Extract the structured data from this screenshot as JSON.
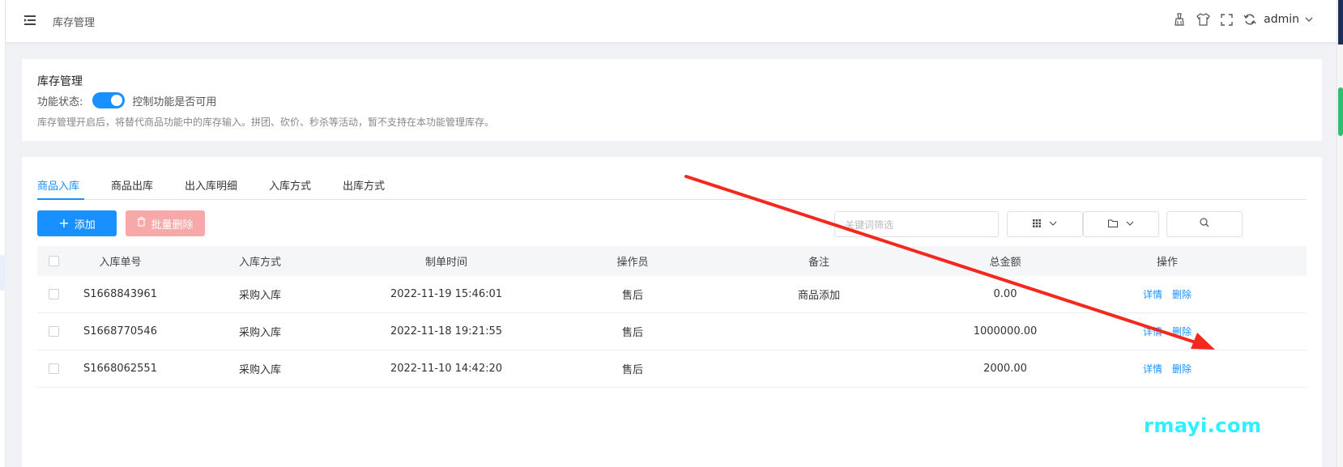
{
  "topbar": {
    "title": "库存管理",
    "icons": [
      "broom-icon",
      "tshirt-icon",
      "fullscreen-icon",
      "refresh-icon"
    ],
    "username": "admin"
  },
  "settings_card": {
    "title": "库存管理",
    "status_label": "功能状态:",
    "switch_on": true,
    "switch_hint": "控制功能是否可用",
    "description": "库存管理开启后，将替代商品功能中的库存输入。拼团、砍价、秒杀等活动，暂不支持在本功能管理库存。"
  },
  "tabs": [
    {
      "label": "商品入库",
      "active": true
    },
    {
      "label": "商品出库",
      "active": false
    },
    {
      "label": "出入库明细",
      "active": false
    },
    {
      "label": "入库方式",
      "active": false
    },
    {
      "label": "出库方式",
      "active": false
    }
  ],
  "toolbar": {
    "add_label": "添加",
    "batch_delete_label": "批量删除",
    "search_placeholder": "关键词筛选"
  },
  "table": {
    "headers": [
      "入库单号",
      "入库方式",
      "制单时间",
      "操作员",
      "备注",
      "总金额",
      "操作"
    ],
    "rows": [
      {
        "no": "S1668843961",
        "method": "采购入库",
        "time": "2022-11-19 15:46:01",
        "operator": "售后",
        "remark": "商品添加",
        "amount": "0.00",
        "detail": "详情",
        "delete": "删除"
      },
      {
        "no": "S1668770546",
        "method": "采购入库",
        "time": "2022-11-18 19:21:55",
        "operator": "售后",
        "remark": "",
        "amount": "1000000.00",
        "detail": "详情",
        "delete": "删除"
      },
      {
        "no": "S1668062551",
        "method": "采购入库",
        "time": "2022-11-10 14:42:20",
        "operator": "售后",
        "remark": "",
        "amount": "2000.00",
        "detail": "详情",
        "delete": "删除"
      }
    ]
  },
  "watermark": "rmayi.com",
  "colors": {
    "primary": "#1890ff",
    "danger_disabled": "#f7a8a8",
    "annotation_arrow": "#f5281e",
    "watermark": "#2ff0ff"
  }
}
